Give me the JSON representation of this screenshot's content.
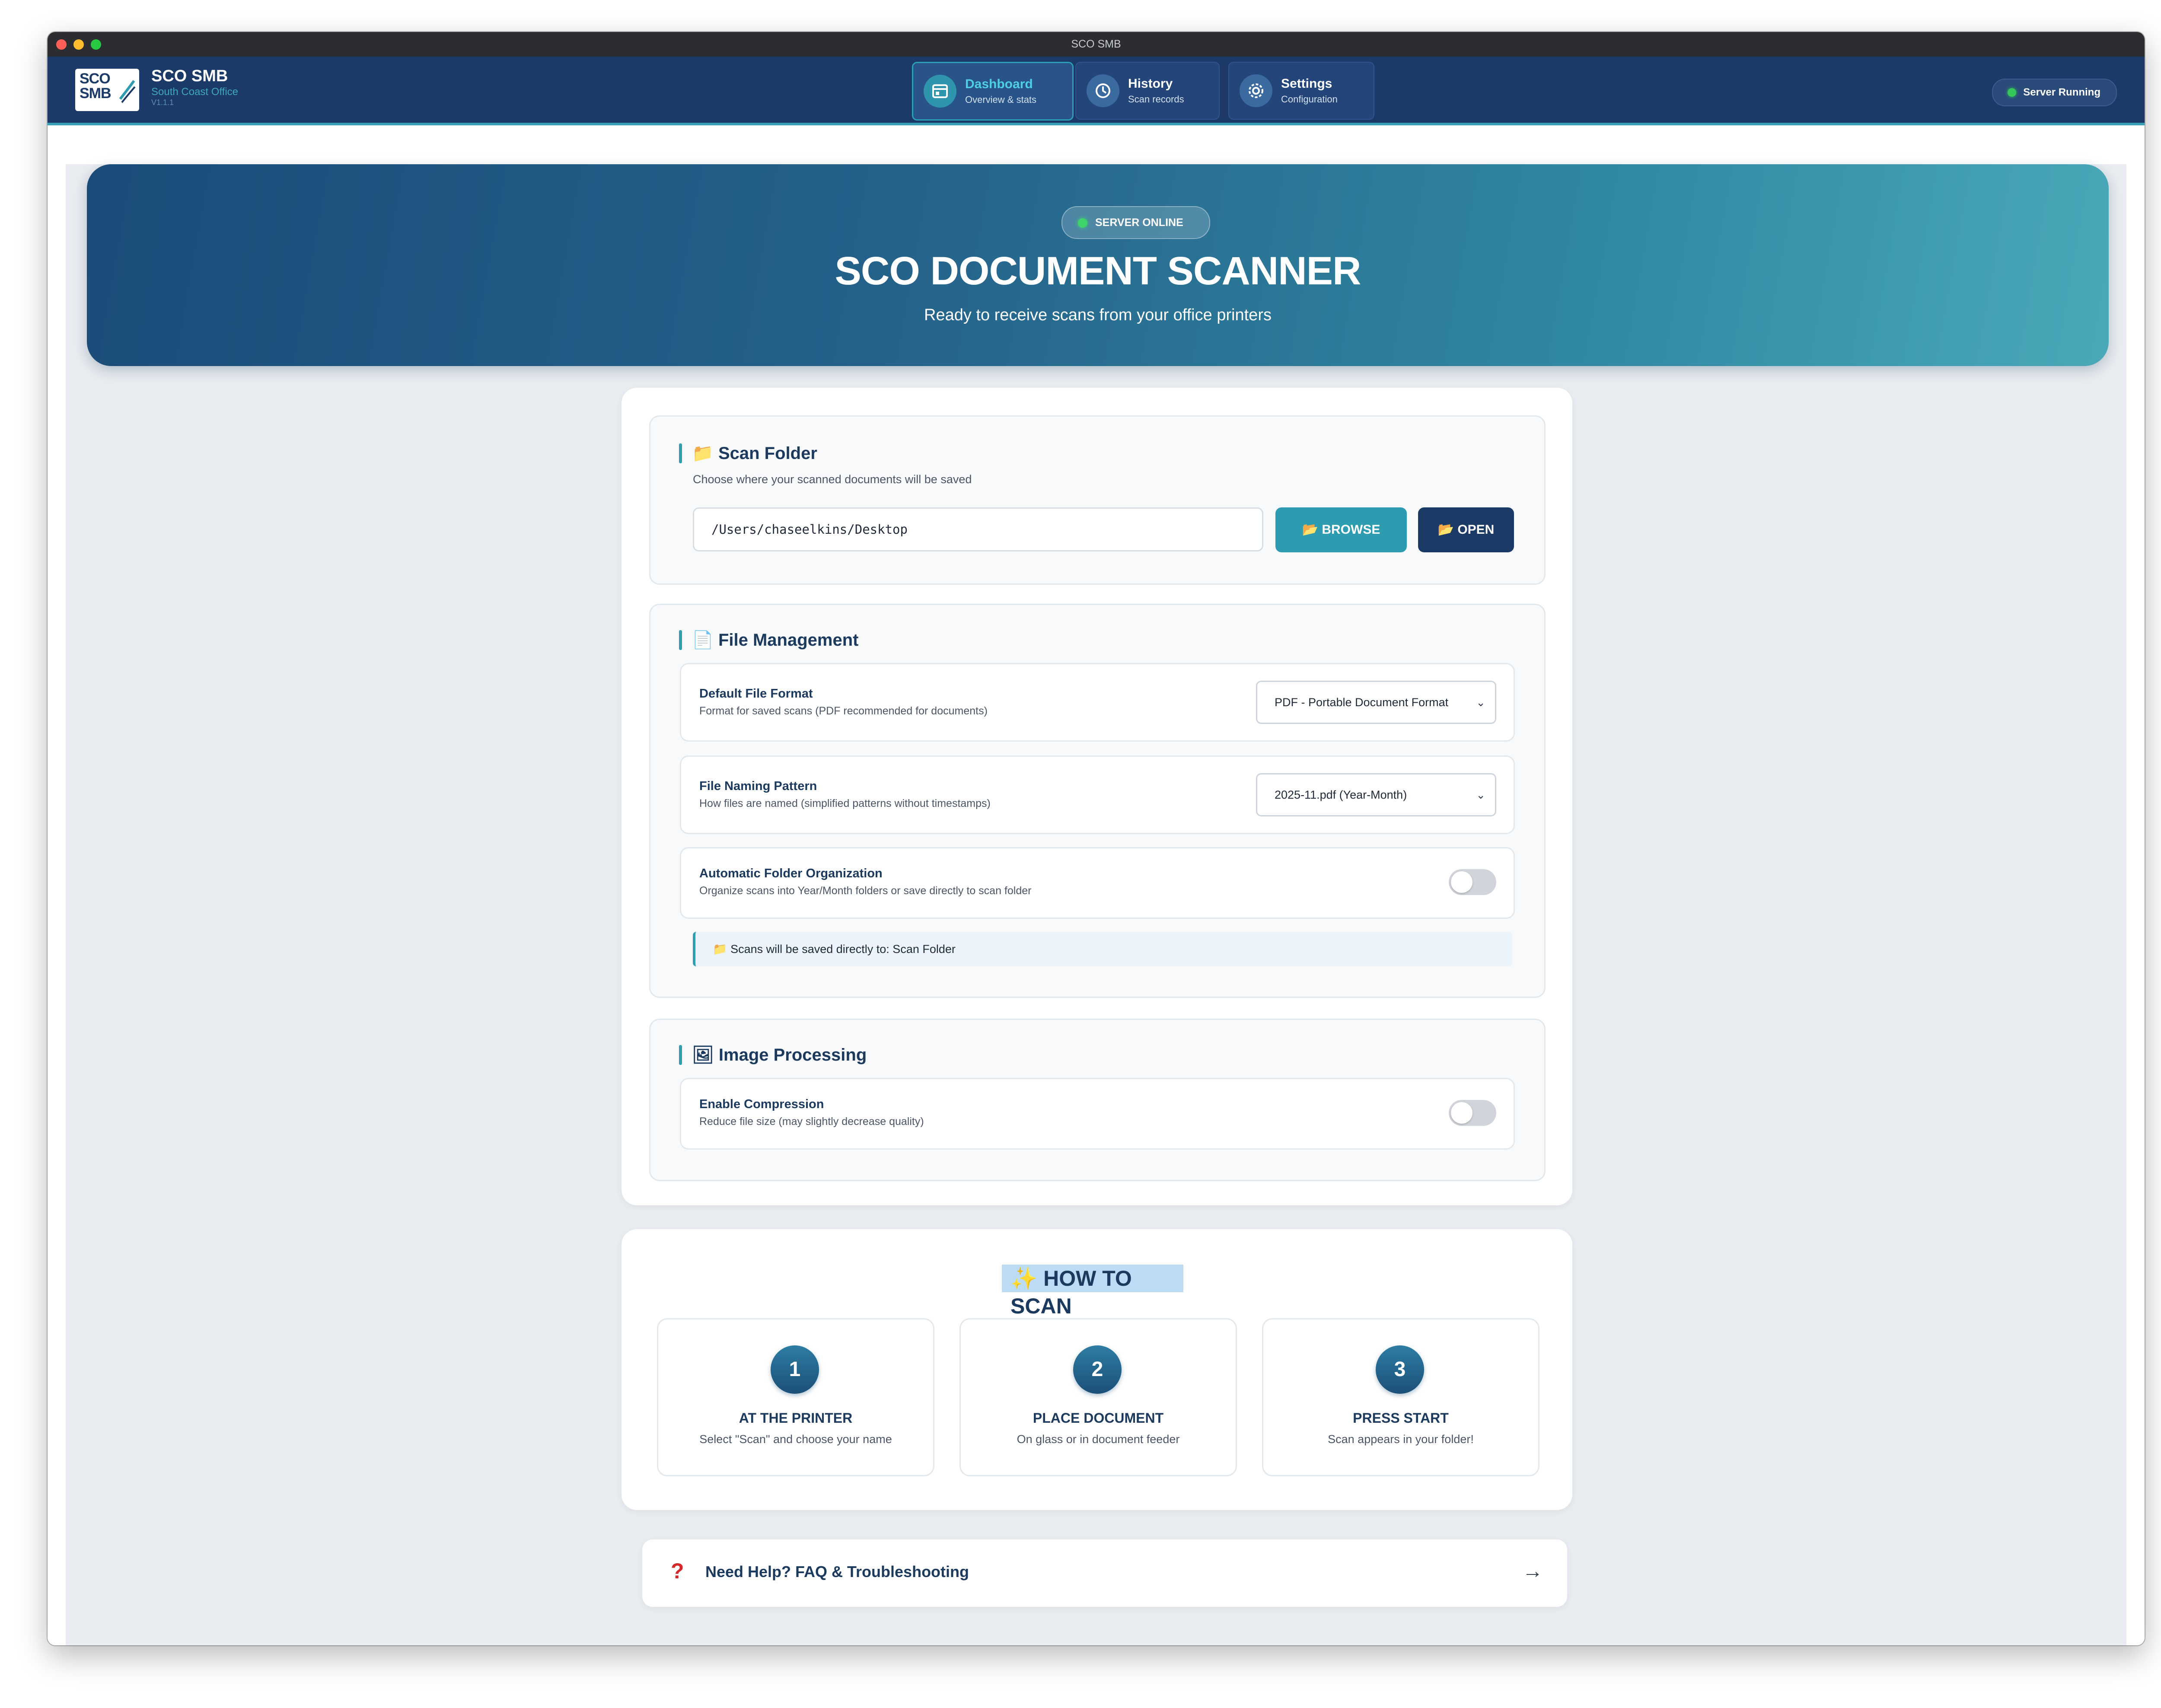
{
  "window": {
    "title": "SCO SMB"
  },
  "brand": {
    "logo_line1": "SCO",
    "logo_line2": "SMB",
    "name": "SCO SMB",
    "subtitle": "South Coast Office",
    "version": "V1.1.1"
  },
  "nav": {
    "tabs": [
      {
        "label": "Dashboard",
        "sub": "Overview & stats",
        "icon": "dashboard-icon",
        "active": true
      },
      {
        "label": "History",
        "sub": "Scan records",
        "icon": "history-icon",
        "active": false
      },
      {
        "label": "Settings",
        "sub": "Configuration",
        "icon": "settings-icon",
        "active": false
      }
    ]
  },
  "server_status": {
    "label": "Server Running",
    "color": "#34c759"
  },
  "hero": {
    "status_pill": "SERVER ONLINE",
    "title": "SCO DOCUMENT SCANNER",
    "subtitle": "Ready to receive scans from your office printers"
  },
  "scan_folder": {
    "icon": "folder-icon",
    "title": "Scan Folder",
    "description": "Choose where your scanned documents will be saved",
    "path": "/Users/chaseelkins/Desktop",
    "browse_label": "BROWSE",
    "open_label": "OPEN"
  },
  "file_management": {
    "icon": "document-icon",
    "title": "File Management",
    "default_format": {
      "label": "Default File Format",
      "description": "Format for saved scans (PDF recommended for documents)",
      "value": "PDF - Portable Document Format"
    },
    "naming_pattern": {
      "label": "File Naming Pattern",
      "description": "How files are named (simplified patterns without timestamps)",
      "value": "2025-11.pdf (Year-Month)"
    },
    "auto_folder": {
      "label": "Automatic Folder Organization",
      "description": "Organize scans into Year/Month folders or save directly to scan folder",
      "enabled": false
    },
    "save_note": "Scans will be saved directly to: Scan Folder"
  },
  "image_processing": {
    "icon": "image-icon",
    "title": "Image Processing",
    "compression": {
      "label": "Enable Compression",
      "description": "Reduce file size (may slightly decrease quality)",
      "enabled": false
    }
  },
  "how_to_scan": {
    "title": "HOW TO SCAN",
    "steps": [
      {
        "number": "1",
        "title": "AT THE PRINTER",
        "description": "Select \"Scan\" and choose your name"
      },
      {
        "number": "2",
        "title": "PLACE DOCUMENT",
        "description": "On glass or in document feeder"
      },
      {
        "number": "3",
        "title": "PRESS START",
        "description": "Scan appears in your folder!"
      }
    ]
  },
  "help": {
    "icon": "question-icon",
    "label": "Need Help? FAQ & Troubleshooting"
  },
  "colors": {
    "header": "#1b3a68",
    "accent": "#2e9cb0",
    "dark_button": "#1b3a66"
  }
}
